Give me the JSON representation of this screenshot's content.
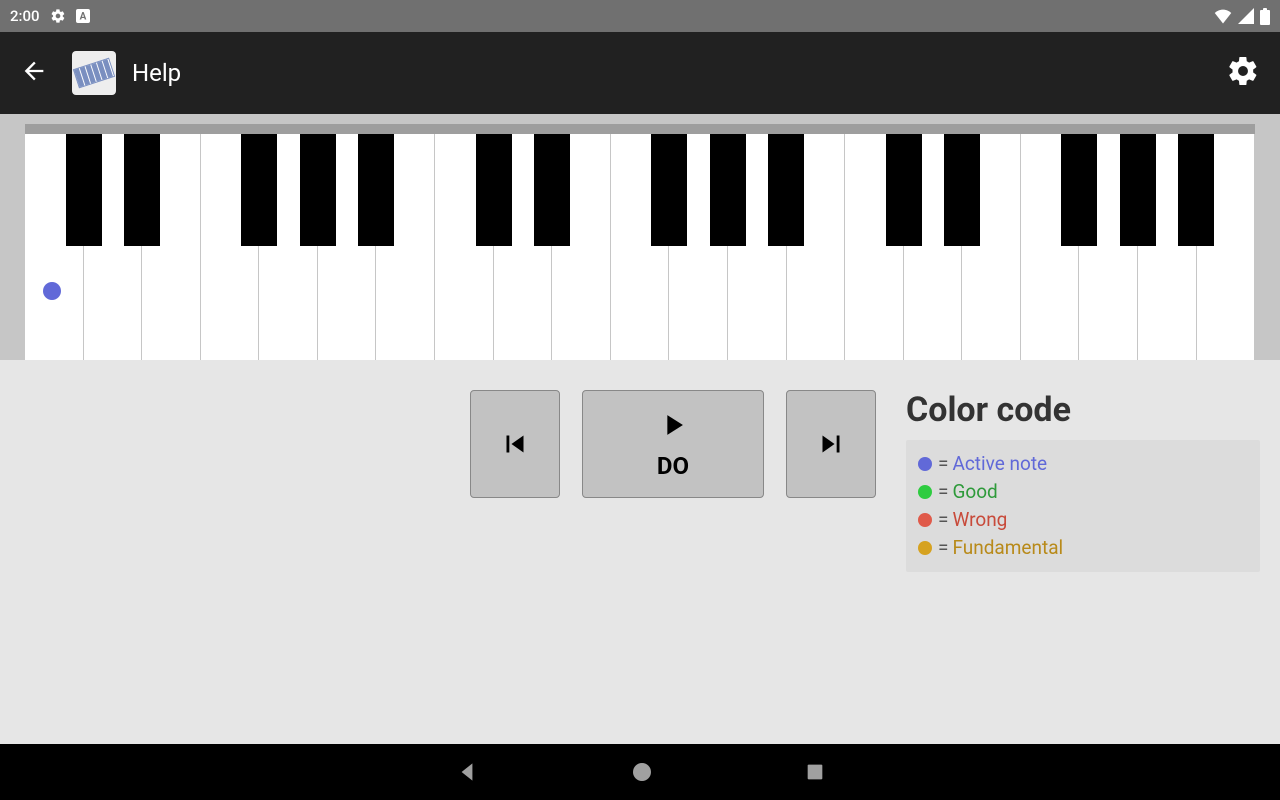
{
  "status": {
    "time": "2:00"
  },
  "header": {
    "title": "Help"
  },
  "controls": {
    "prev_icon": "skip-previous",
    "play_icon": "play",
    "play_label": "DO",
    "next_icon": "skip-next"
  },
  "piano": {
    "white_key_count": 21,
    "black_key_positions": [
      0,
      1,
      3,
      4,
      5,
      7,
      8,
      10,
      11,
      12,
      14,
      15,
      17,
      18,
      19
    ],
    "active_dot_key_index": 0
  },
  "legend": {
    "title": "Color code",
    "items": [
      {
        "color": "#6169d8",
        "text_color": "#6169d8",
        "label": "Active note"
      },
      {
        "color": "#2ecc40",
        "text_color": "#2e9a3a",
        "label": "Good"
      },
      {
        "color": "#e05a4a",
        "text_color": "#c84a3a",
        "label": "Wrong"
      },
      {
        "color": "#d6a220",
        "text_color": "#b88a1a",
        "label": "Fundamental"
      }
    ]
  }
}
